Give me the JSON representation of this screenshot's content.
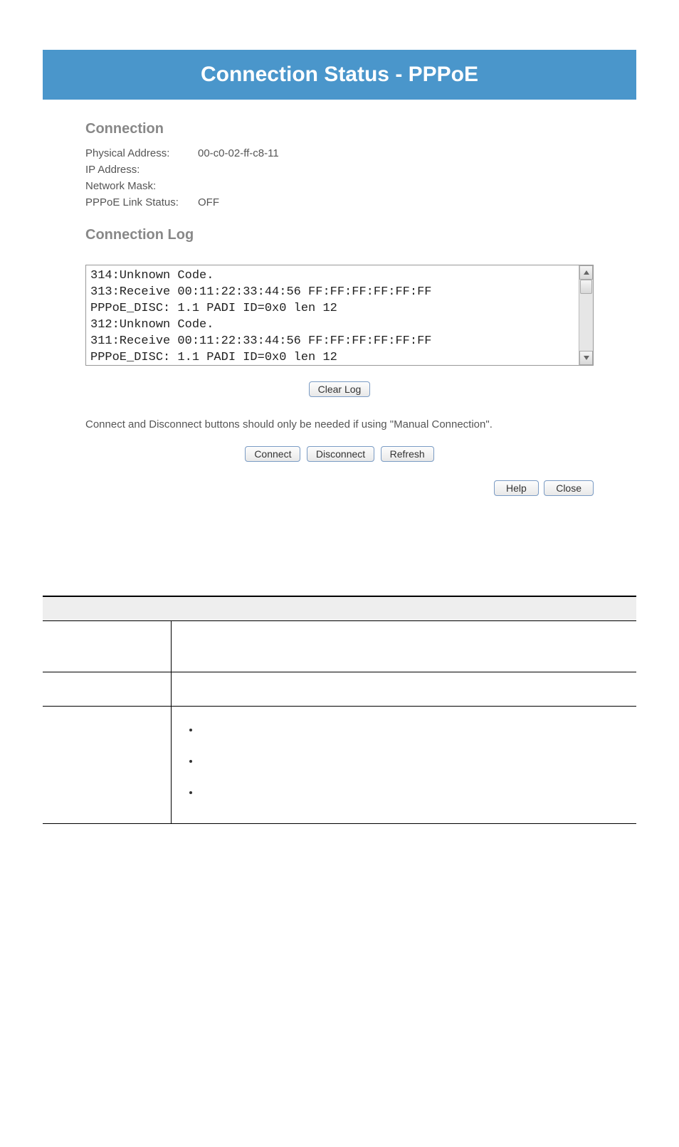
{
  "header": {
    "title": "Connection Status - PPPoE"
  },
  "connection": {
    "section_title": "Connection",
    "rows": [
      {
        "label": "Physical Address:",
        "value": "00-c0-02-ff-c8-11"
      },
      {
        "label": "IP Address:",
        "value": ""
      },
      {
        "label": "Network Mask:",
        "value": ""
      },
      {
        "label": "PPPoE Link Status:",
        "value": "OFF"
      }
    ]
  },
  "log": {
    "section_title": "Connection Log",
    "text": "314:Unknown Code.\n313:Receive 00:11:22:33:44:56 FF:FF:FF:FF:FF:FF\nPPPoE_DISC: 1.1 PADI ID=0x0 len 12\n312:Unknown Code.\n311:Receive 00:11:22:33:44:56 FF:FF:FF:FF:FF:FF\nPPPoE_DISC: 1.1 PADI ID=0x0 len 12",
    "clear_label": "Clear Log"
  },
  "hint": "Connect and Disconnect buttons should only be needed if using \"Manual Connection\".",
  "buttons": {
    "connect": "Connect",
    "disconnect": "Disconnect",
    "refresh": "Refresh",
    "help": "Help",
    "close": "Close"
  }
}
